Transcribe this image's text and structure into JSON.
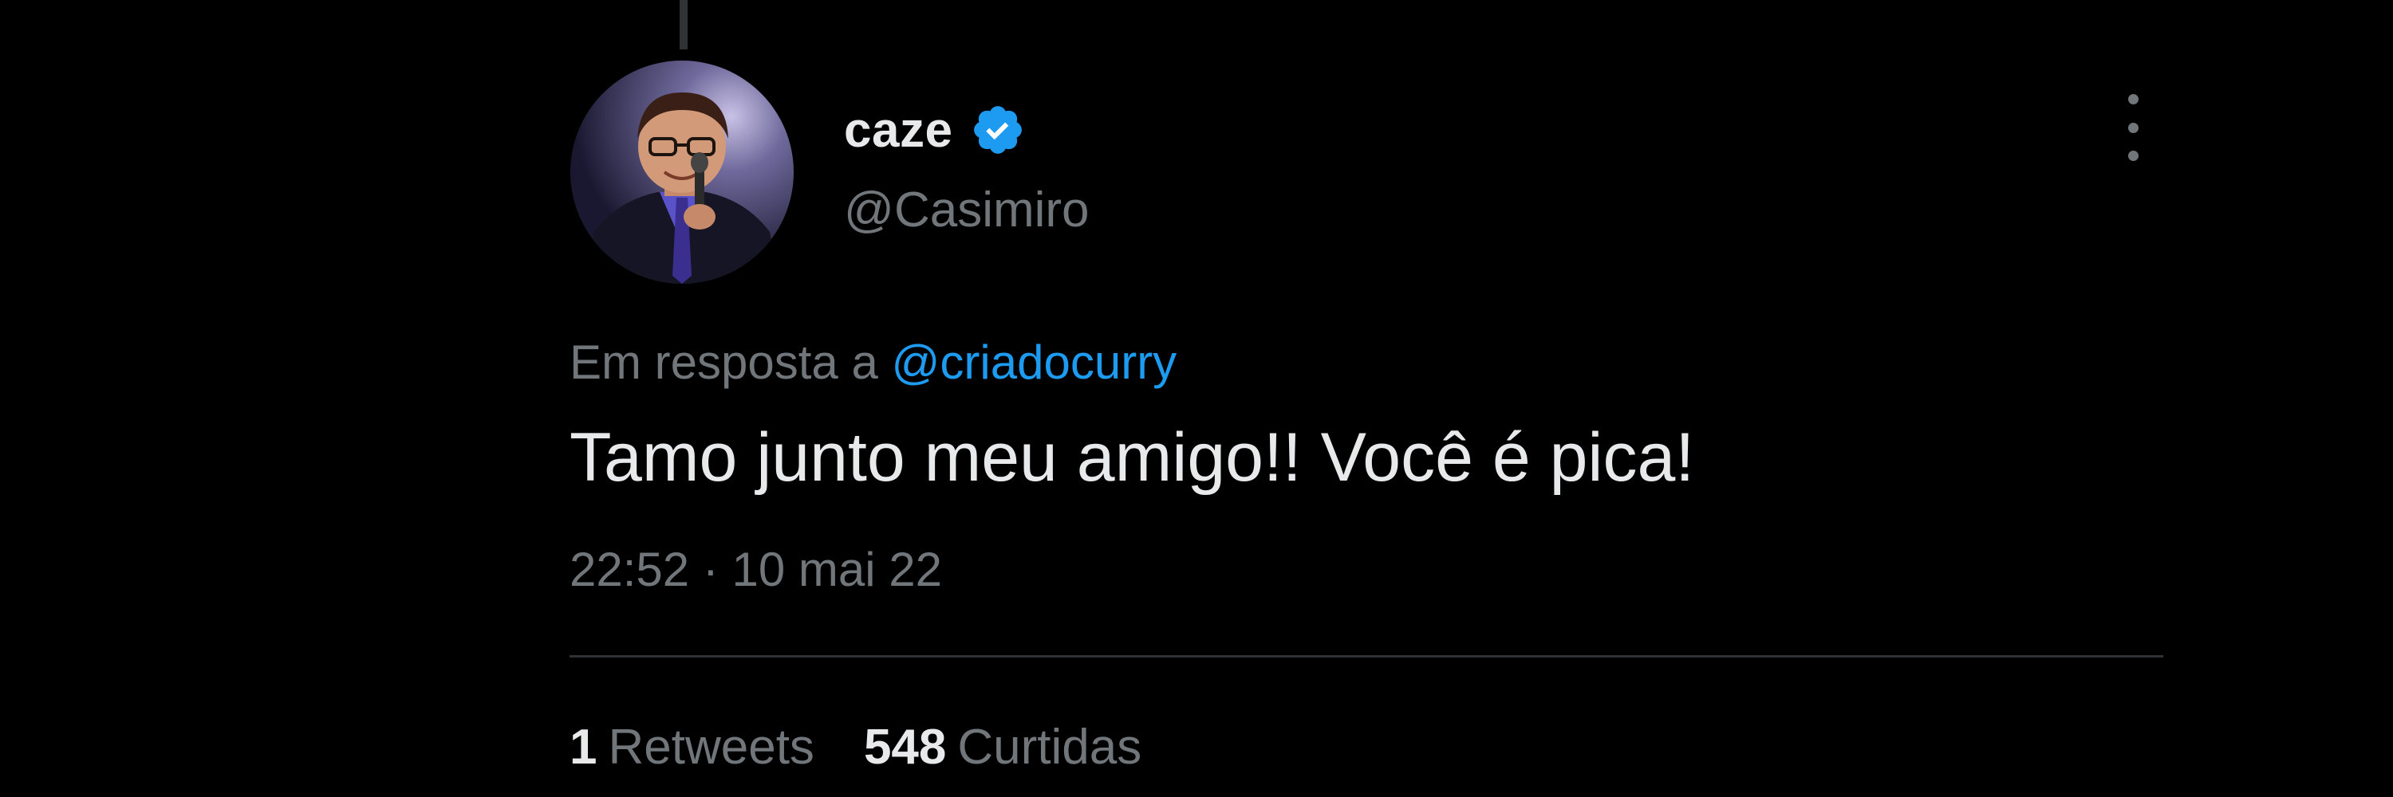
{
  "tweet": {
    "display_name": "caze",
    "handle": "@Casimiro",
    "verified": true,
    "reply_prefix": "Em resposta a",
    "reply_to": "@criadocurry",
    "text": "Tamo junto meu amigo!! Você é pica!",
    "timestamp": "22:52 · 10 mai 22",
    "retweets": {
      "count": "1",
      "label": "Retweets"
    },
    "likes": {
      "count": "548",
      "label": "Curtidas"
    }
  },
  "icons": {
    "verified": "verified-badge-icon",
    "more": "more-vertical-icon",
    "avatar": "profile-avatar"
  },
  "colors": {
    "background": "#000000",
    "primary_text": "#e7e9ea",
    "secondary_text": "#71767b",
    "accent": "#1d9bf0",
    "divider": "#2f3336"
  }
}
